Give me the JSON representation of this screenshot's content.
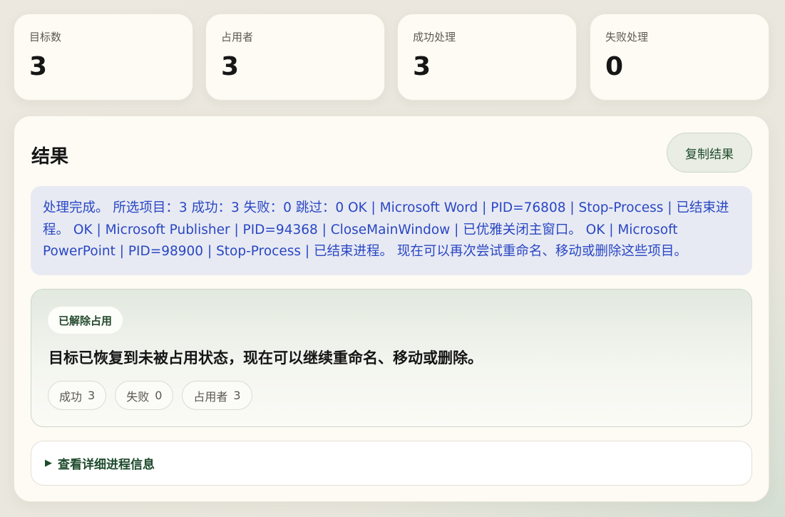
{
  "stats": [
    {
      "label": "目标数",
      "value": "3"
    },
    {
      "label": "占用者",
      "value": "3"
    },
    {
      "label": "成功处理",
      "value": "3"
    },
    {
      "label": "失败处理",
      "value": "0"
    }
  ],
  "result": {
    "title": "结果",
    "copy_button": "复制结果",
    "message": "处理完成。 所选项目：3 成功：3 失败：0 跳过：0 OK | Microsoft Word | PID=76808 | Stop-Process | 已结束进程。 OK | Microsoft Publisher | PID=94368 | CloseMainWindow | 已优雅关闭主窗口。 OK | Microsoft PowerPoint | PID=98900 | Stop-Process | 已结束进程。 现在可以再次尝试重命名、移动或删除这些项目。"
  },
  "status": {
    "badge": "已解除占用",
    "heading": "目标已恢复到未被占用状态，现在可以继续重命名、移动或删除。",
    "chips": [
      {
        "label": "成功",
        "value": "3"
      },
      {
        "label": "失败",
        "value": "0"
      },
      {
        "label": "占用者",
        "value": "3"
      }
    ]
  },
  "details": {
    "arrow": "▶",
    "label": "查看详细进程信息"
  }
}
